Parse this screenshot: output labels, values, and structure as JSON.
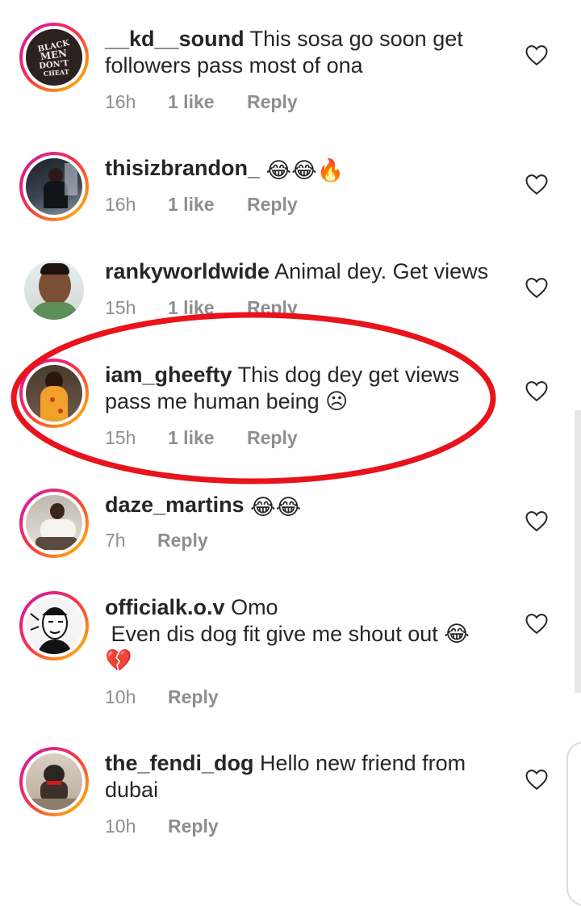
{
  "comments": [
    {
      "username": "__kd__sound",
      "text": "This sosa go soon get followers pass most of ona",
      "time": "16h",
      "likes": "1 like",
      "reply": "Reply",
      "avatar_text": [
        "BLACK",
        "MEN",
        "DON'T",
        "CHEAT"
      ]
    },
    {
      "username": "thisizbrandon_",
      "text": "😂😂🔥",
      "time": "16h",
      "likes": "1 like",
      "reply": "Reply"
    },
    {
      "username": "rankyworldwide",
      "text": "Animal dey. Get views",
      "time": "15h",
      "likes": "1 like",
      "reply": "Reply"
    },
    {
      "username": "iam_gheefty",
      "text": "This dog dey get views pass me human being ☹",
      "time": "15h",
      "likes": "1 like",
      "reply": "Reply"
    },
    {
      "username": "daze_martins",
      "text": "😂😂",
      "time": "7h",
      "reply": "Reply"
    },
    {
      "username": "officialk.o.v",
      "text": "Omo",
      "text2": " Even dis dog fit give me shout out 😂",
      "text3": "💔",
      "time": "10h",
      "reply": "Reply"
    },
    {
      "username": "the_fendi_dog",
      "text": "Hello new friend from dubai",
      "time": "10h",
      "reply": "Reply"
    }
  ],
  "colors": {
    "annotation": "#e8131b",
    "meta": "#8e8e8e",
    "text": "#262626"
  },
  "icons": {
    "like": "heart-outline-icon"
  }
}
